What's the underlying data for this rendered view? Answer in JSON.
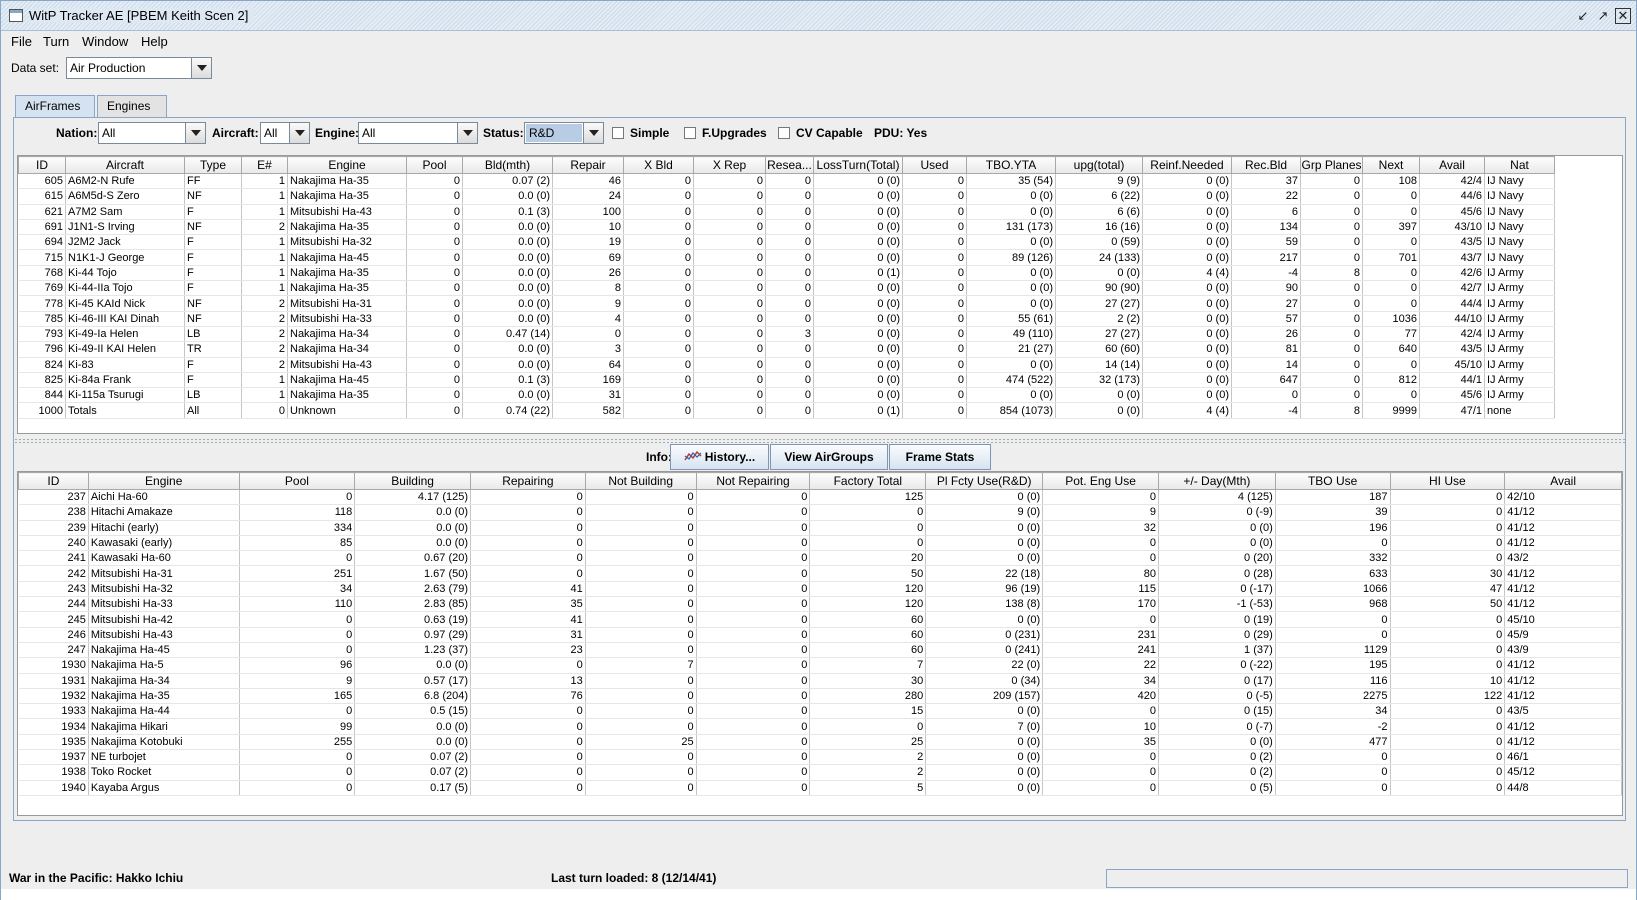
{
  "window": {
    "title": "WitP Tracker AE [PBEM Keith Scen 2]"
  },
  "menu": [
    "File",
    "Turn",
    "Window",
    "Help"
  ],
  "dataset": {
    "label": "Data set:",
    "value": "Air Production"
  },
  "tabs": [
    "AirFrames",
    "Engines"
  ],
  "filters": {
    "nation_label": "Nation:",
    "nation_value": "All",
    "aircraft_label": "Aircraft:",
    "aircraft_value": "All",
    "engine_label": "Engine:",
    "engine_value": "All",
    "status_label": "Status:",
    "status_value": "R&D",
    "simple": "Simple",
    "fupgrades": "F.Upgrades",
    "cvcapable": "CV Capable",
    "pdu": "PDU: Yes"
  },
  "airframes": {
    "columns": [
      "ID",
      "Aircraft",
      "Type",
      "E#",
      "Engine",
      "Pool",
      "Bld(mth)",
      "Repair",
      "X Bld",
      "X Rep",
      "Resea...",
      "LossTurn(Total)",
      "Used",
      "TBO.YTA",
      "upg(total)",
      "Reinf.Needed",
      "Rec.Bld",
      "Grp Planes",
      "Next",
      "Avail",
      "Nat"
    ],
    "rows": [
      [
        "605",
        "A6M2-N Rufe",
        "FF",
        "1",
        "Nakajima Ha-35",
        "0",
        "0.07 (2)",
        "46",
        "0",
        "0",
        "0",
        "0 (0)",
        "0",
        "35 (54)",
        "9 (9)",
        "0 (0)",
        "37",
        "0",
        "108",
        "42/4",
        "IJ Navy"
      ],
      [
        "615",
        "A6M5d-S Zero",
        "NF",
        "1",
        "Nakajima Ha-35",
        "0",
        "0.0 (0)",
        "24",
        "0",
        "0",
        "0",
        "0 (0)",
        "0",
        "0 (0)",
        "6 (22)",
        "0 (0)",
        "22",
        "0",
        "0",
        "44/6",
        "IJ Navy"
      ],
      [
        "621",
        "A7M2 Sam",
        "F",
        "1",
        "Mitsubishi Ha-43",
        "0",
        "0.1 (3)",
        "100",
        "0",
        "0",
        "0",
        "0 (0)",
        "0",
        "0 (0)",
        "6 (6)",
        "0 (0)",
        "6",
        "0",
        "0",
        "45/6",
        "IJ Navy"
      ],
      [
        "691",
        "J1N1-S Irving",
        "NF",
        "2",
        "Nakajima Ha-35",
        "0",
        "0.0 (0)",
        "10",
        "0",
        "0",
        "0",
        "0 (0)",
        "0",
        "131 (173)",
        "16 (16)",
        "0 (0)",
        "134",
        "0",
        "397",
        "43/10",
        "IJ Navy"
      ],
      [
        "694",
        "J2M2 Jack",
        "F",
        "1",
        "Mitsubishi Ha-32",
        "0",
        "0.0 (0)",
        "19",
        "0",
        "0",
        "0",
        "0 (0)",
        "0",
        "0 (0)",
        "0 (59)",
        "0 (0)",
        "59",
        "0",
        "0",
        "43/5",
        "IJ Navy"
      ],
      [
        "715",
        "N1K1-J George",
        "F",
        "1",
        "Nakajima Ha-45",
        "0",
        "0.0 (0)",
        "69",
        "0",
        "0",
        "0",
        "0 (0)",
        "0",
        "89 (126)",
        "24 (133)",
        "0 (0)",
        "217",
        "0",
        "701",
        "43/7",
        "IJ Navy"
      ],
      [
        "768",
        "Ki-44 Tojo",
        "F",
        "1",
        "Nakajima Ha-35",
        "0",
        "0.0 (0)",
        "26",
        "0",
        "0",
        "0",
        "0 (1)",
        "0",
        "0 (0)",
        "0 (0)",
        "4 (4)",
        "-4",
        "8",
        "0",
        "42/6",
        "IJ Army"
      ],
      [
        "769",
        "Ki-44-IIa Tojo",
        "F",
        "1",
        "Nakajima Ha-35",
        "0",
        "0.0 (0)",
        "8",
        "0",
        "0",
        "0",
        "0 (0)",
        "0",
        "0 (0)",
        "90 (90)",
        "0 (0)",
        "90",
        "0",
        "0",
        "42/7",
        "IJ Army"
      ],
      [
        "778",
        "Ki-45 KAId Nick",
        "NF",
        "2",
        "Mitsubishi Ha-31",
        "0",
        "0.0 (0)",
        "9",
        "0",
        "0",
        "0",
        "0 (0)",
        "0",
        "0 (0)",
        "27 (27)",
        "0 (0)",
        "27",
        "0",
        "0",
        "44/4",
        "IJ Army"
      ],
      [
        "785",
        "Ki-46-III KAI Dinah",
        "NF",
        "2",
        "Mitsubishi Ha-33",
        "0",
        "0.0 (0)",
        "4",
        "0",
        "0",
        "0",
        "0 (0)",
        "0",
        "55 (61)",
        "2 (2)",
        "0 (0)",
        "57",
        "0",
        "1036",
        "44/10",
        "IJ Army"
      ],
      [
        "793",
        "Ki-49-Ia Helen",
        "LB",
        "2",
        "Nakajima Ha-34",
        "0",
        "0.47 (14)",
        "0",
        "0",
        "0",
        "3",
        "0 (0)",
        "0",
        "49 (110)",
        "27 (27)",
        "0 (0)",
        "26",
        "0",
        "77",
        "42/4",
        "IJ Army"
      ],
      [
        "796",
        "Ki-49-II KAI Helen",
        "TR",
        "2",
        "Nakajima Ha-34",
        "0",
        "0.0 (0)",
        "3",
        "0",
        "0",
        "0",
        "0 (0)",
        "0",
        "21 (27)",
        "60 (60)",
        "0 (0)",
        "81",
        "0",
        "640",
        "43/5",
        "IJ Army"
      ],
      [
        "824",
        "Ki-83",
        "F",
        "2",
        "Mitsubishi Ha-43",
        "0",
        "0.0 (0)",
        "64",
        "0",
        "0",
        "0",
        "0 (0)",
        "0",
        "0 (0)",
        "14 (14)",
        "0 (0)",
        "14",
        "0",
        "0",
        "45/10",
        "IJ Army"
      ],
      [
        "825",
        "Ki-84a Frank",
        "F",
        "1",
        "Nakajima Ha-45",
        "0",
        "0.1 (3)",
        "169",
        "0",
        "0",
        "0",
        "0 (0)",
        "0",
        "474 (522)",
        "32 (173)",
        "0 (0)",
        "647",
        "0",
        "812",
        "44/1",
        "IJ Army"
      ],
      [
        "844",
        "Ki-115a Tsurugi",
        "LB",
        "1",
        "Nakajima Ha-35",
        "0",
        "0.0 (0)",
        "31",
        "0",
        "0",
        "0",
        "0 (0)",
        "0",
        "0 (0)",
        "0 (0)",
        "0 (0)",
        "0",
        "0",
        "0",
        "45/6",
        "IJ Army"
      ],
      [
        "1000",
        "Totals",
        "All",
        "0",
        "Unknown",
        "0",
        "0.74 (22)",
        "582",
        "0",
        "0",
        "0",
        "0 (1)",
        "0",
        "854 (1073)",
        "0 (0)",
        "4 (4)",
        "-4",
        "8",
        "9999",
        "47/1",
        "none"
      ]
    ]
  },
  "info": {
    "label": "Info:",
    "history": "History...",
    "view_airgroups": "View AirGroups",
    "frame_stats": "Frame Stats"
  },
  "engines": {
    "columns": [
      "ID",
      "Engine",
      "Pool",
      "Building",
      "Repairing",
      "Not Building",
      "Not Repairing",
      "Factory Total",
      "Pl Fcty Use(R&D)",
      "Pot. Eng Use",
      "+/- Day(Mth)",
      "TBO Use",
      "HI Use",
      "Avail"
    ],
    "rows": [
      [
        "237",
        "Aichi Ha-60",
        "0",
        "4.17 (125)",
        "0",
        "0",
        "0",
        "125",
        "0 (0)",
        "0",
        "4 (125)",
        "187",
        "0",
        "42/10"
      ],
      [
        "238",
        "Hitachi Amakaze",
        "118",
        "0.0 (0)",
        "0",
        "0",
        "0",
        "0",
        "9 (0)",
        "9",
        "0 (-9)",
        "39",
        "0",
        "41/12"
      ],
      [
        "239",
        "Hitachi (early)",
        "334",
        "0.0 (0)",
        "0",
        "0",
        "0",
        "0",
        "0 (0)",
        "32",
        "0 (0)",
        "196",
        "0",
        "41/12"
      ],
      [
        "240",
        "Kawasaki (early)",
        "85",
        "0.0 (0)",
        "0",
        "0",
        "0",
        "0",
        "0 (0)",
        "0",
        "0 (0)",
        "0",
        "0",
        "41/12"
      ],
      [
        "241",
        "Kawasaki Ha-60",
        "0",
        "0.67 (20)",
        "0",
        "0",
        "0",
        "20",
        "0 (0)",
        "0",
        "0 (20)",
        "332",
        "0",
        "43/2"
      ],
      [
        "242",
        "Mitsubishi Ha-31",
        "251",
        "1.67 (50)",
        "0",
        "0",
        "0",
        "50",
        "22 (18)",
        "80",
        "0 (28)",
        "633",
        "30",
        "41/12"
      ],
      [
        "243",
        "Mitsubishi Ha-32",
        "34",
        "2.63 (79)",
        "41",
        "0",
        "0",
        "120",
        "96 (19)",
        "115",
        "0 (-17)",
        "1066",
        "47",
        "41/12"
      ],
      [
        "244",
        "Mitsubishi Ha-33",
        "110",
        "2.83 (85)",
        "35",
        "0",
        "0",
        "120",
        "138 (8)",
        "170",
        "-1 (-53)",
        "968",
        "50",
        "41/12"
      ],
      [
        "245",
        "Mitsubishi Ha-42",
        "0",
        "0.63 (19)",
        "41",
        "0",
        "0",
        "60",
        "0 (0)",
        "0",
        "0 (19)",
        "0",
        "0",
        "45/10"
      ],
      [
        "246",
        "Mitsubishi Ha-43",
        "0",
        "0.97 (29)",
        "31",
        "0",
        "0",
        "60",
        "0 (231)",
        "231",
        "0 (29)",
        "0",
        "0",
        "45/9"
      ],
      [
        "247",
        "Nakajima Ha-45",
        "0",
        "1.23 (37)",
        "23",
        "0",
        "0",
        "60",
        "0 (241)",
        "241",
        "1 (37)",
        "1129",
        "0",
        "43/9"
      ],
      [
        "1930",
        "Nakajima Ha-5",
        "96",
        "0.0 (0)",
        "0",
        "7",
        "0",
        "7",
        "22 (0)",
        "22",
        "0 (-22)",
        "195",
        "0",
        "41/12"
      ],
      [
        "1931",
        "Nakajima Ha-34",
        "9",
        "0.57 (17)",
        "13",
        "0",
        "0",
        "30",
        "0 (34)",
        "34",
        "0 (17)",
        "116",
        "10",
        "41/12"
      ],
      [
        "1932",
        "Nakajima Ha-35",
        "165",
        "6.8 (204)",
        "76",
        "0",
        "0",
        "280",
        "209 (157)",
        "420",
        "0 (-5)",
        "2275",
        "122",
        "41/12"
      ],
      [
        "1933",
        "Nakajima Ha-44",
        "0",
        "0.5 (15)",
        "0",
        "0",
        "0",
        "15",
        "0 (0)",
        "0",
        "0 (15)",
        "34",
        "0",
        "43/5"
      ],
      [
        "1934",
        "Nakajima Hikari",
        "99",
        "0.0 (0)",
        "0",
        "0",
        "0",
        "0",
        "7 (0)",
        "10",
        "0 (-7)",
        "-2",
        "0",
        "41/12"
      ],
      [
        "1935",
        "Nakajima Kotobuki",
        "255",
        "0.0 (0)",
        "0",
        "25",
        "0",
        "25",
        "0 (0)",
        "35",
        "0 (0)",
        "477",
        "0",
        "41/12"
      ],
      [
        "1937",
        "NE turbojet",
        "0",
        "0.07 (2)",
        "0",
        "0",
        "0",
        "2",
        "0 (0)",
        "0",
        "0 (2)",
        "0",
        "0",
        "46/1"
      ],
      [
        "1938",
        "Toko Rocket",
        "0",
        "0.07 (2)",
        "0",
        "0",
        "0",
        "2",
        "0 (0)",
        "0",
        "0 (2)",
        "0",
        "0",
        "45/12"
      ],
      [
        "1940",
        "Kayaba Argus",
        "0",
        "0.17 (5)",
        "0",
        "0",
        "0",
        "5",
        "0 (0)",
        "0",
        "0 (5)",
        "0",
        "0",
        "44/8"
      ]
    ]
  },
  "status": {
    "left": "War in the Pacific: Hakko Ichiu",
    "middle": "Last turn loaded: 8 (12/14/41)"
  },
  "icons": {
    "window": "window-icon",
    "minimize": "minimize-icon",
    "maximize": "maximize-icon",
    "close": "close-icon",
    "history": "chart-icon"
  },
  "colors": {
    "titlebar": "#dde8f3",
    "panel_border": "#8aa6c6",
    "selected_combo": "#b8cde4"
  }
}
